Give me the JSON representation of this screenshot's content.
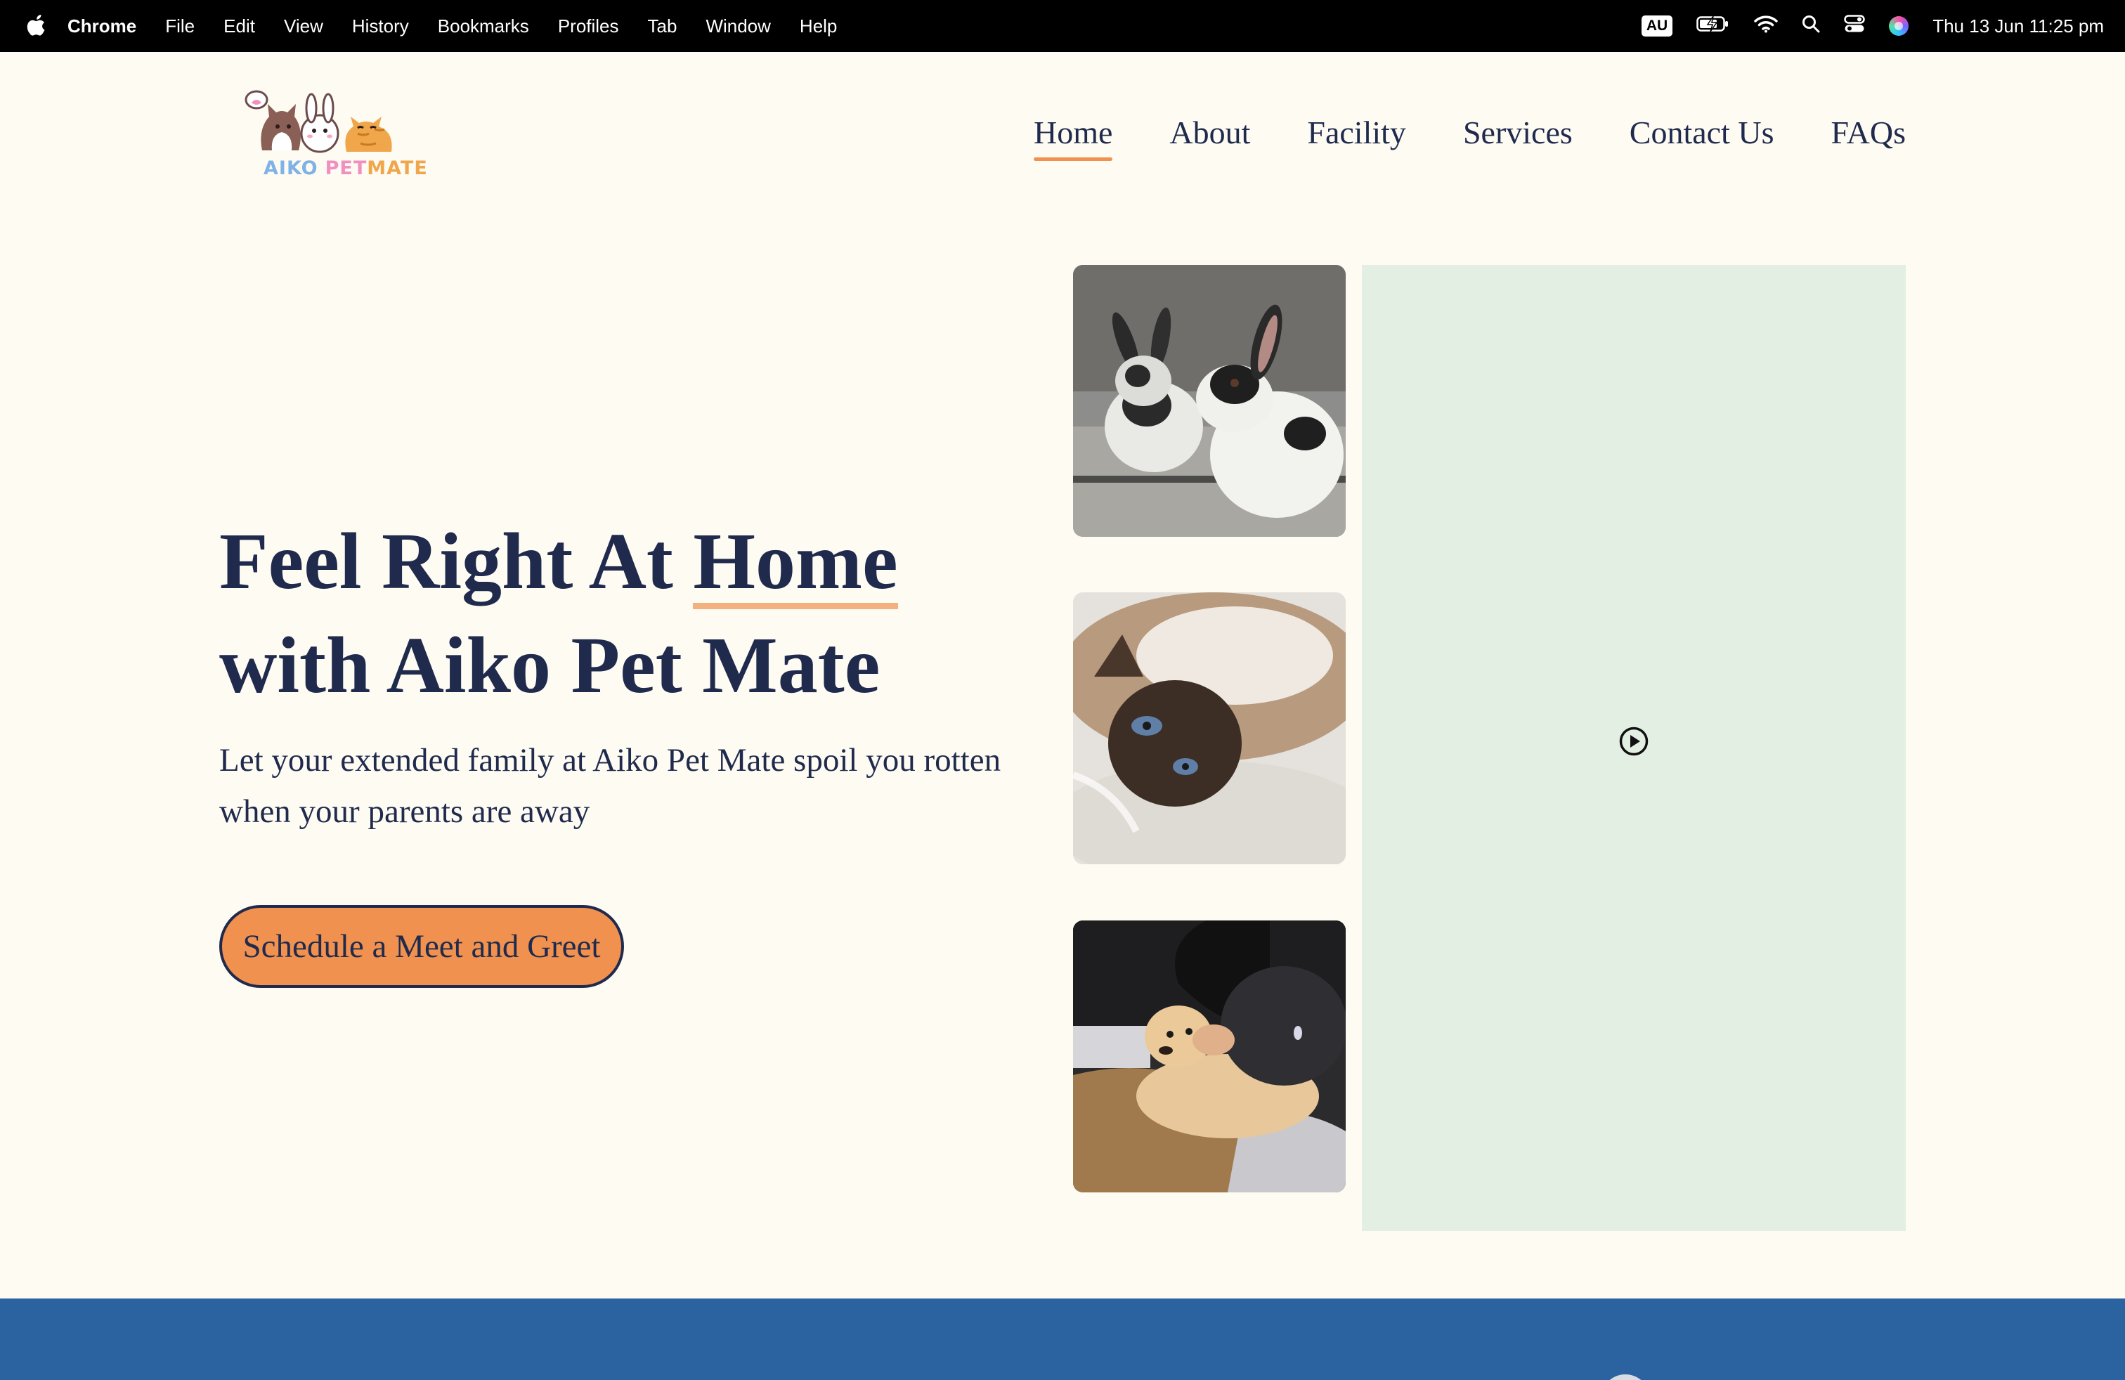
{
  "menubar": {
    "app": "Chrome",
    "items": [
      "File",
      "Edit",
      "View",
      "History",
      "Bookmarks",
      "Profiles",
      "Tab",
      "Window",
      "Help"
    ],
    "keyboard": "AU",
    "datetime": "Thu 13 Jun  11:25 pm"
  },
  "logo": {
    "part1": "AIKO",
    "part2": "PET",
    "part3": "MATE",
    "colors": [
      "#7fb2e5",
      "#f08fc0",
      "#f0a64a"
    ]
  },
  "nav": {
    "items": [
      "Home",
      "About",
      "Facility",
      "Services",
      "Contact Us",
      "FAQs"
    ],
    "active": "Home"
  },
  "hero": {
    "headline_part1": "Feel Right At",
    "headline_highlight": "Home",
    "headline_line2": "with Aiko Pet Mate",
    "subtext": "Let your extended family at Aiko Pet Mate spoil you rotten when your parents are away",
    "cta": "Schedule a Meet and Greet"
  },
  "colors": {
    "background": "#fefbf2",
    "navy": "#1f2a4d",
    "accent": "#f0914f",
    "video_bg": "#e3efe3",
    "band": "#2b63a0"
  },
  "icons": [
    "apple-icon",
    "battery-icon",
    "wifi-icon",
    "search-icon",
    "control-center-icon",
    "siri-icon",
    "play-icon"
  ]
}
